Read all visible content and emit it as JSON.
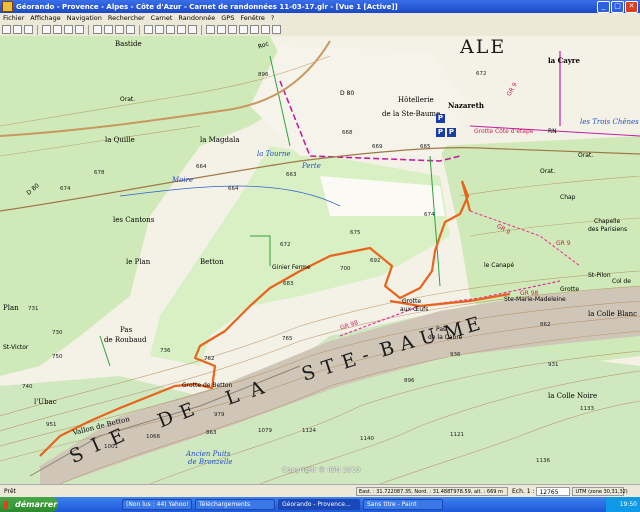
{
  "window": {
    "title": "Géorando - Provence - Alpes - Côte d'Azur - Carnet de randonnées 11-03-17.glr - [Vue 1 [Active]]",
    "buttons": [
      "_",
      "□",
      "✕"
    ]
  },
  "menu": [
    "Fichier",
    "Affichage",
    "Navigation",
    "Rechercher",
    "Carnet",
    "Randonnée",
    "GPS",
    "Fenêtre",
    "?"
  ],
  "map": {
    "place_labels": {
      "la_bastide": "Bastide",
      "la_quille": "la Quille",
      "la_magdala": "la Magdala",
      "la_tourne": "la Tourne",
      "les_cantons": "les Cantons",
      "le_plan": "le Plan",
      "betton": "Betton",
      "plan": "Plan",
      "pas_de_roubaud_1": "Pas",
      "pas_de_roubaud_2": "de Roubaud",
      "st_victor": "St-Victor",
      "lubac": "l'Ubac",
      "vallon_de_betton": "Vallon de Betton",
      "grotte_de_betton": "Grotte de Betton",
      "ginier_ferme": "Ginier Ferme",
      "grotte_aux_oufs_1": "Grotte",
      "grotte_aux_oufs_2": "aux Œufs",
      "pas_de_la_cabre_1": "Pas",
      "pas_de_la_cabre_2": "de la Cabre",
      "hotellerie": "Hôtellerie",
      "de_la_ste_baume": "de la Ste-Baume",
      "nazareth": "Nazareth",
      "la_cayre": "la Cayre",
      "les_trois_chenes": "les Trois Chênes",
      "orat": "Orat.",
      "orat2": "Orat.",
      "orat3": "Orat.",
      "chapelle": "Chapelle",
      "des_parisiens": "des Parisiens",
      "le_canape": "le Canapé",
      "st_pilon": "St-Pilon",
      "grotte_ste_madeleine_1": "Grotte",
      "grotte_ste_madeleine_2": "Ste-Marie-Madeleine",
      "la_colle_blanche": "la Colle Blanc",
      "la_colle_noire": "la Colle Noire",
      "ancien_puits_1": "Ancien Puits",
      "ancien_puits_2": "de Bronzelle",
      "moire": "Moire",
      "perte": "Perte",
      "col_de": "Col de",
      "ale": "ALE",
      "chap": "Chap"
    },
    "big_label": [
      "S",
      "I",
      "E",
      "D",
      "E",
      "L",
      "A",
      "S",
      "T",
      "E",
      "-",
      "B",
      "A",
      "U",
      "M",
      "E"
    ],
    "trail_labels": [
      "GR 9",
      "GR 98",
      "GR 9",
      "GR 98",
      "GR 9",
      "Roc",
      "D 80",
      "D 80",
      "RN",
      "Grotte Côte d'étape"
    ],
    "altitudes": [
      "896",
      "672",
      "678",
      "674",
      "668",
      "665",
      "669",
      "664",
      "663",
      "675",
      "674",
      "672",
      "683",
      "692",
      "700",
      "762",
      "736",
      "750",
      "765",
      "979",
      "951",
      "1001",
      "1068",
      "1079",
      "863",
      "936",
      "862",
      "896",
      "931",
      "1124",
      "1140",
      "1121",
      "1133",
      "664",
      "731",
      "730",
      "740",
      "1136"
    ],
    "parking_label": "P",
    "copyright": "Copyright © IGN 2010"
  },
  "statusbar": {
    "state": "Prêt",
    "coords": "East. : 31.722087.35, Nord. : 31.488T978.59, alt. : 669 m",
    "scale_label": "Ech. 1 :",
    "scale_value": "12765",
    "utm": "UTM (zone 30,31,32)"
  },
  "taskbar": {
    "start": "démarrer",
    "tasks": [
      "(Non lus : 44) Yahoo! ...",
      "Téléchargements",
      "Géorando - Provence...",
      "Sans titre - Paint"
    ],
    "clock": "19:50"
  },
  "colors": {
    "track": "#e8641c",
    "forest": "#c8e8b0",
    "contour": "#b08050",
    "boundary": "#c020a0",
    "water": "#3060d0",
    "cliff": "#a89a88"
  }
}
